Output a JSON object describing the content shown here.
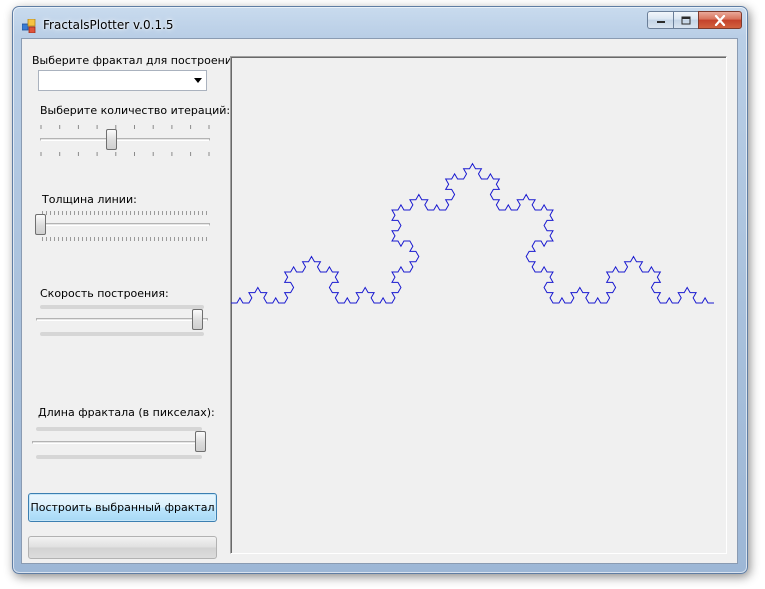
{
  "window": {
    "title": "FractalsPlotter v.0.1.5",
    "icon": "fractal-app-icon",
    "controls": [
      "minimize-icon",
      "maximize-icon",
      "close-icon"
    ]
  },
  "panel": {
    "fractal_label": "Выберите фрактал для построения",
    "fractal_select_value": "",
    "iterations_label": "Выберите количество итераций:",
    "iterations": {
      "min": 0,
      "max": 9,
      "value": 4
    },
    "thickness_label": "Толщина линии:",
    "thickness": {
      "value": 0
    },
    "speed_label": "Скорость построения:",
    "speed": {
      "value": 1.0
    },
    "length_label": "Длина фрактала (в пикселах):",
    "length": {
      "value": 1.0
    },
    "build_button": "Построить выбранный фрактал",
    "progress": 0
  },
  "plot": {
    "fractal": "koch-curve",
    "iterations": 4,
    "line_color": "#1a1ad0"
  }
}
